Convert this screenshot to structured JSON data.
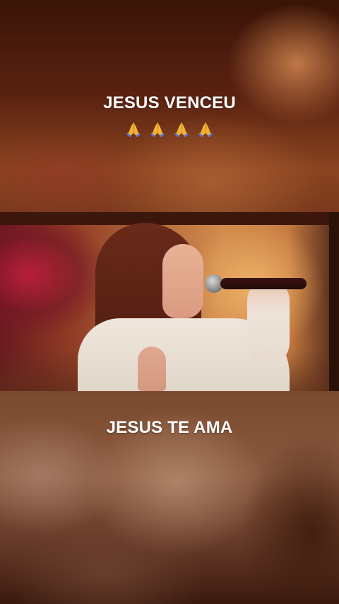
{
  "caption_top": "JESUS VENCEU",
  "caption_emojis": [
    "folded-hands",
    "folded-hands",
    "folded-hands",
    "folded-hands"
  ],
  "caption_bottom": "JESUS TE AMA",
  "colors": {
    "text": "#ffffff",
    "emoji_skin": "#f2b233",
    "emoji_sleeve": "#5a7bd8"
  }
}
